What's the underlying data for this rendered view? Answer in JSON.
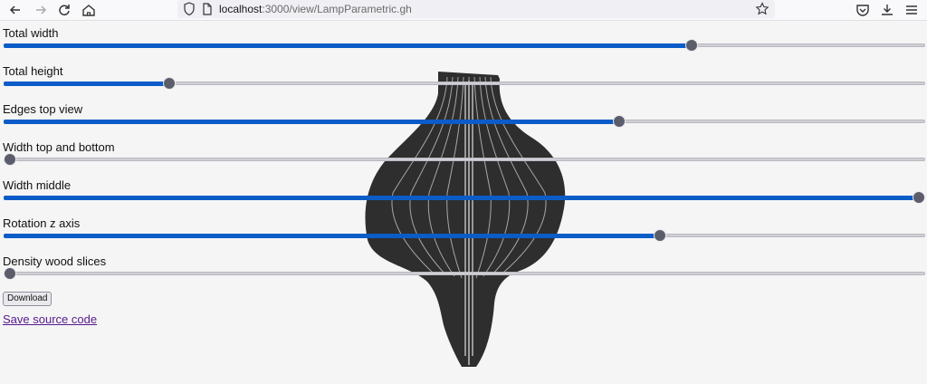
{
  "browser": {
    "url_host": "localhost",
    "url_path": ":3000/view/LampParametric.gh"
  },
  "sliders": [
    {
      "label": "Total width",
      "value": 0.75
    },
    {
      "label": "Total height",
      "value": 0.175
    },
    {
      "label": "Edges top view",
      "value": 0.67
    },
    {
      "label": "Width top and bottom",
      "value": 0.0
    },
    {
      "label": "Width middle",
      "value": 1.0
    },
    {
      "label": "Rotation z axis",
      "value": 0.715
    },
    {
      "label": "Density wood slices",
      "value": 0.0
    }
  ],
  "download_label": "Download",
  "source_link": "Save source code",
  "colors": {
    "accent": "#0b5cc8",
    "thumb": "#5b5d6b",
    "lamp": "#2e2e2e",
    "link": "#551a8b"
  }
}
